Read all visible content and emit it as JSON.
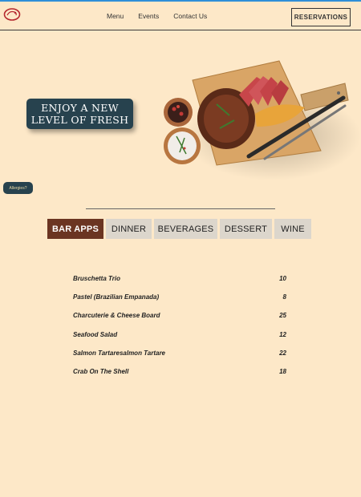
{
  "header": {
    "logo_icon": "logo-icon",
    "nav": [
      "Menu",
      "Events",
      "Contact Us"
    ],
    "reservations_label": "RESERVATIONS"
  },
  "hero": {
    "badge_line1": "ENJOY A NEW",
    "badge_line2": "LEVEL OF FRESH"
  },
  "allergies_label": "Allergies?",
  "tabs": [
    "BAR APPS",
    "DINNER",
    "BEVERAGES",
    "DESSERT",
    "WINE"
  ],
  "active_tab": "BAR APPS",
  "menu_items": [
    {
      "name": "Bruschetta Trio",
      "price": "10"
    },
    {
      "name": "Pastel (Brazilian Empanada)",
      "price": "8"
    },
    {
      "name": "Charcuterie & Cheese Board",
      "price": "25"
    },
    {
      "name": "Seafood Salad",
      "price": "12"
    },
    {
      "name": "Salmon Tartaresalmon Tartare",
      "price": "22"
    },
    {
      "name": "Crab On The Shell",
      "price": "18"
    }
  ],
  "colors": {
    "background": "#fde8c8",
    "accent_dark": "#27424e",
    "active_tab": "#6b3522",
    "tab_bg": "#dcd6cc"
  }
}
